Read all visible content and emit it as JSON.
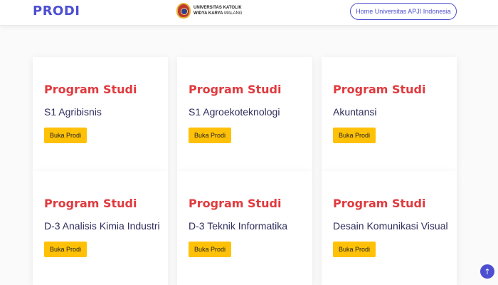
{
  "header": {
    "brand": "PRODI",
    "logo": {
      "line1": "UNIVERSITAS KATOLIK",
      "line2_bold": "WIDYA KARYA",
      "line2_rest": " MALANG",
      "icon": "university-seal"
    },
    "home_button": "Home Universitas APJI Indonesia"
  },
  "programs": [
    {
      "heading": "Program Studi",
      "name": "S1 Agribisnis",
      "button": "Buka Prodi"
    },
    {
      "heading": "Program Studi",
      "name": "S1 Agroekoteknologi",
      "button": "Buka Prodi"
    },
    {
      "heading": "Program Studi",
      "name": "Akuntansi",
      "button": "Buka Prodi"
    },
    {
      "heading": "Program Studi",
      "name": "D-3 Analisis Kimia Industri",
      "button": "Buka Prodi"
    },
    {
      "heading": "Program Studi",
      "name": "D-3 Teknik Informatika",
      "button": "Buka Prodi"
    },
    {
      "heading": "Program Studi",
      "name": "Desain Komunikasi Visual",
      "button": "Buka Prodi"
    }
  ],
  "scroll_top": {
    "icon": "arrow-up-icon",
    "glyph": "↑"
  },
  "colors": {
    "accent": "#4d4fd0",
    "heading_red": "#e03a3e",
    "button_yellow": "#ffc107"
  }
}
